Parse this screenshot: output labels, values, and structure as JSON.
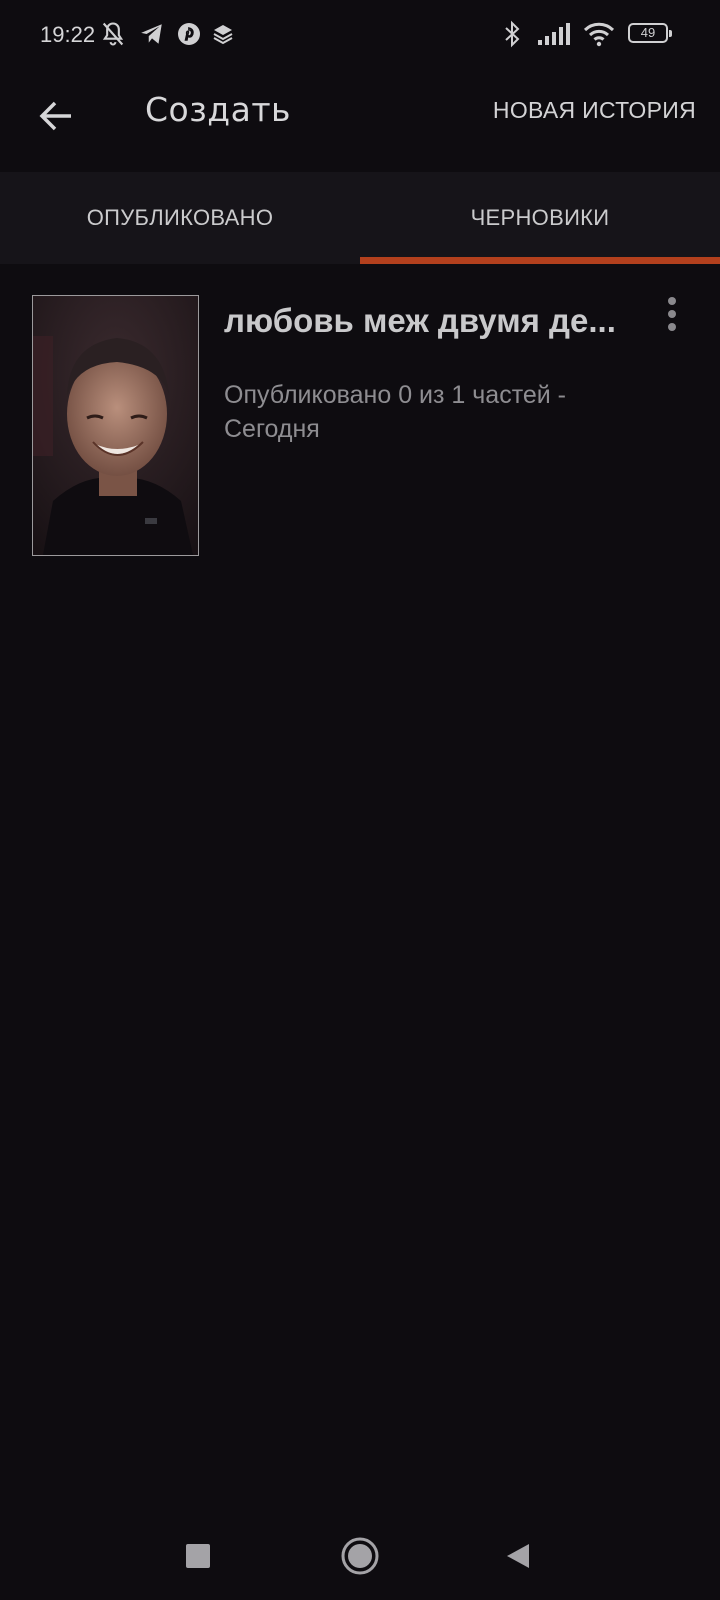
{
  "status_bar": {
    "time": "19:22",
    "battery_level": "49",
    "icons": [
      "notifications-off-icon",
      "telegram-icon",
      "pinterest-icon",
      "layers-icon",
      "bluetooth-icon",
      "signal-icon",
      "wifi-icon",
      "battery-icon"
    ]
  },
  "app_bar": {
    "title": "Создать",
    "action_label": "НОВАЯ ИСТОРИЯ",
    "back_icon": "arrow-left-icon"
  },
  "tabs": [
    {
      "label": "ОПУБЛИКОВАНО",
      "selected": false
    },
    {
      "label": "ЧЕРНОВИКИ",
      "selected": true
    }
  ],
  "colors": {
    "background": "#0e0c10",
    "tab_bar": "#161419",
    "accent": "#b3401d"
  },
  "stories": [
    {
      "title": "любовь меж двумя де...",
      "meta": "Опубликовано 0 из 1 частей - Сегодня",
      "cover_icon": "story-cover-photo"
    }
  ],
  "nav_bar": {
    "icons": [
      "recents-square-icon",
      "home-circle-icon",
      "back-triangle-icon"
    ]
  }
}
